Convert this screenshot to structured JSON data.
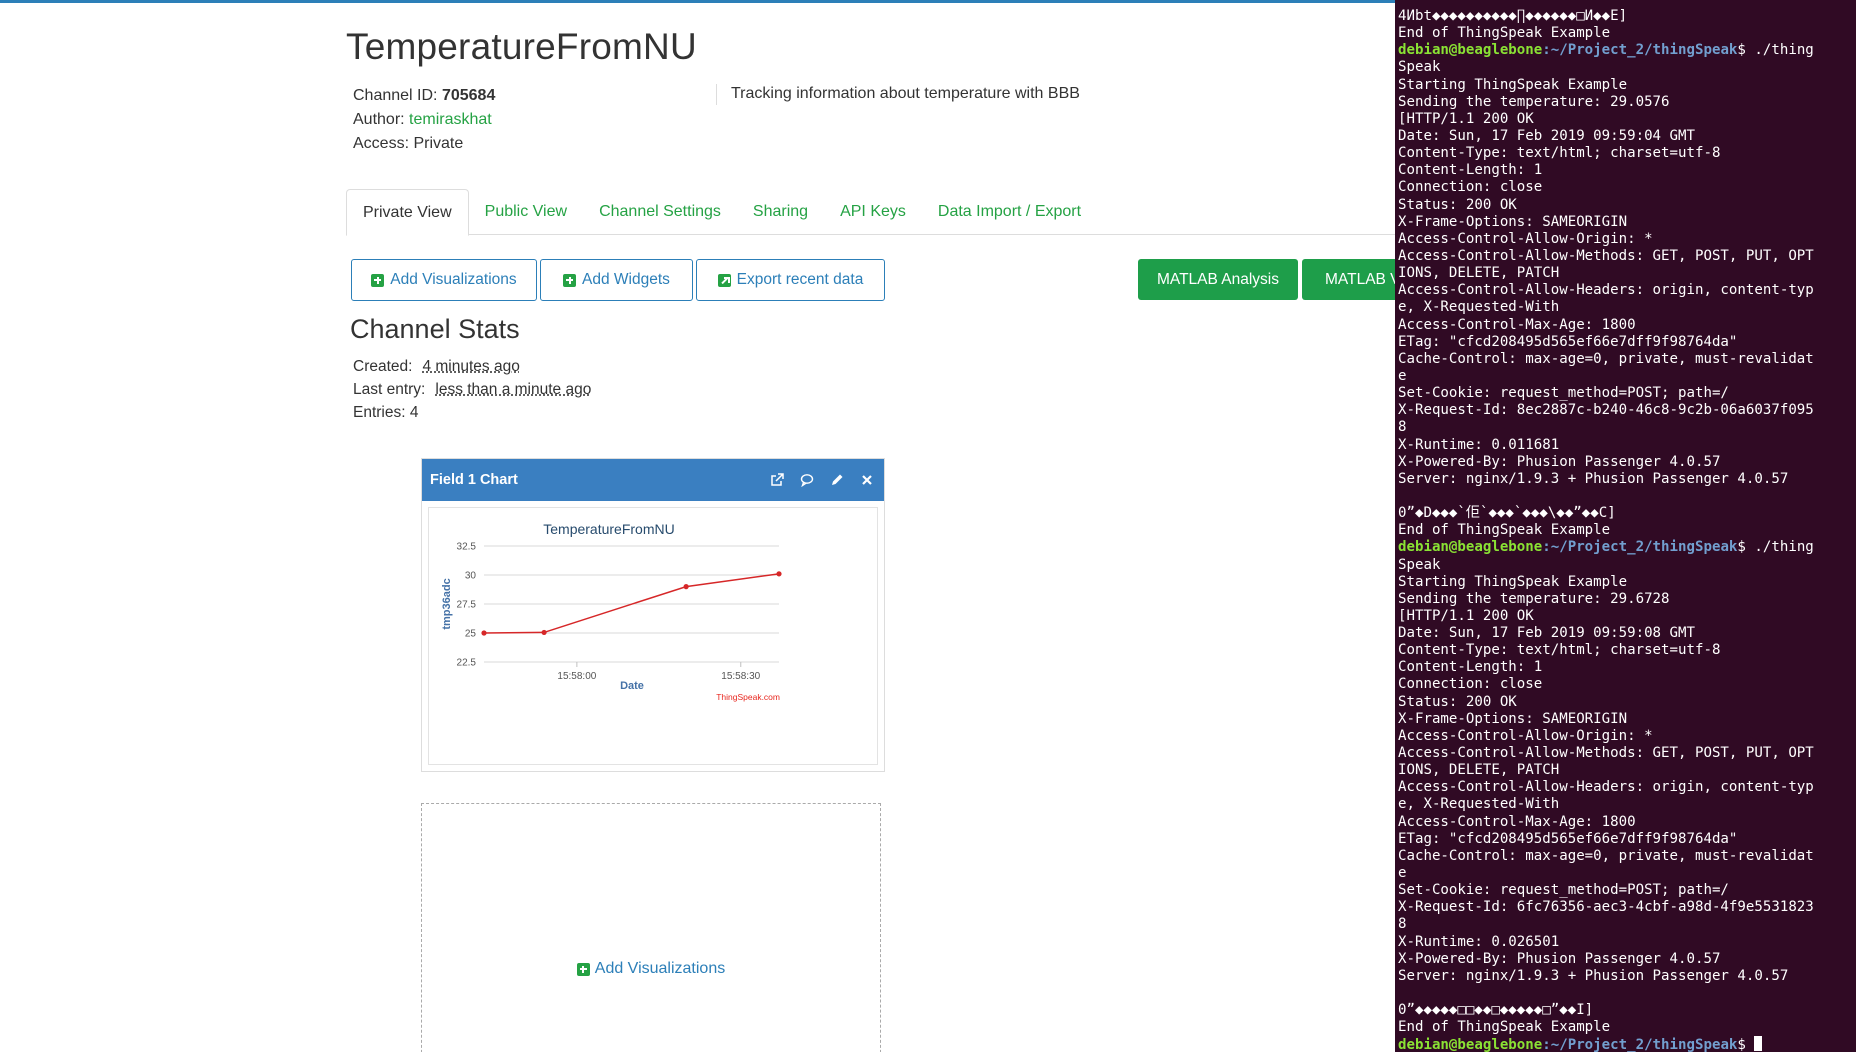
{
  "channel": {
    "title": "TemperatureFromNU",
    "id_label": "Channel ID:",
    "id_value": "705684",
    "author_label": "Author:",
    "author_value": "temiraskhat",
    "access_label": "Access:",
    "access_value": "Private",
    "description": "Tracking information about temperature with BBB"
  },
  "tabs": [
    {
      "label": "Private View",
      "active": true
    },
    {
      "label": "Public View"
    },
    {
      "label": "Channel Settings"
    },
    {
      "label": "Sharing"
    },
    {
      "label": "API Keys"
    },
    {
      "label": "Data Import / Export"
    }
  ],
  "toolbar": {
    "add_visualizations": "Add Visualizations",
    "add_widgets": "Add Widgets",
    "export_recent": "Export recent data",
    "matlab_analysis": "MATLAB Analysis",
    "matlab_visualization": "MATLAB Visualization"
  },
  "stats": {
    "title": "Channel Stats",
    "created_label": "Created:",
    "created_value": "4 minutes ago",
    "last_entry_label": "Last entry:",
    "last_entry_value": "less than a minute ago",
    "entries": "Entries: 4"
  },
  "widget": {
    "title": "Field 1 Chart",
    "icons": [
      "external-link-icon",
      "comment-icon",
      "pencil-icon",
      "close-icon"
    ],
    "header_color": "#3a7fc1"
  },
  "empty_widget": {
    "label": "Add Visualizations"
  },
  "colors": {
    "accent_green": "#25a244",
    "link_blue": "#2c7fb8",
    "button_green": "#1e9e4a",
    "series_red": "#d62728",
    "terminal_bg": "#300a24",
    "prompt_user": "#8ae234",
    "prompt_path": "#729fcf"
  },
  "chart_data": {
    "type": "line",
    "title": "TemperatureFromNU",
    "xlabel": "Date",
    "ylabel": "tmp36adc",
    "credit": "ThingSpeak.com",
    "x_ticks": [
      "15:58:00",
      "15:58:30"
    ],
    "x_tick_seconds": [
      0,
      30
    ],
    "y_ticks": [
      22.5,
      25,
      27.5,
      30,
      32.5
    ],
    "ylim": [
      22.5,
      32.5
    ],
    "xlim_seconds": [
      -17,
      37
    ],
    "grid": true,
    "series": [
      {
        "x_seconds": [
          -17,
          -6,
          20,
          37
        ],
        "values": [
          25,
          25.05,
          29,
          30.1
        ]
      }
    ]
  },
  "terminal": {
    "lines": [
      {
        "text": "4Иbt◆◆◆◆◆◆◆◆◆◆∏◆◆◆◆◆◆□И◆◆E]"
      },
      {
        "text": "End of ThingSpeak Example"
      },
      {
        "prompt": true,
        "user": "debian@beaglebone",
        "path": ":~/Project_2/thingSpeak",
        "cmd": "$ ./thing"
      },
      {
        "text": "Speak"
      },
      {
        "text": "Starting ThingSpeak Example"
      },
      {
        "text": "Sending the temperature: 29.0576"
      },
      {
        "text": "[HTTP/1.1 200 OK"
      },
      {
        "text": "Date: Sun, 17 Feb 2019 09:59:04 GMT"
      },
      {
        "text": "Content-Type: text/html; charset=utf-8"
      },
      {
        "text": "Content-Length: 1"
      },
      {
        "text": "Connection: close"
      },
      {
        "text": "Status: 200 OK"
      },
      {
        "text": "X-Frame-Options: SAMEORIGIN"
      },
      {
        "text": "Access-Control-Allow-Origin: *"
      },
      {
        "text": "Access-Control-Allow-Methods: GET, POST, PUT, OPT"
      },
      {
        "text": "IONS, DELETE, PATCH"
      },
      {
        "text": "Access-Control-Allow-Headers: origin, content-typ"
      },
      {
        "text": "e, X-Requested-With"
      },
      {
        "text": "Access-Control-Max-Age: 1800"
      },
      {
        "text": "ETag: \"cfcd208495d565ef66e7dff9f98764da\""
      },
      {
        "text": "Cache-Control: max-age=0, private, must-revalidat"
      },
      {
        "text": "e"
      },
      {
        "text": "Set-Cookie: request_method=POST; path=/"
      },
      {
        "text": "X-Request-Id: 8ec2887c-b240-46c8-9c2b-06a6037f095"
      },
      {
        "text": "8"
      },
      {
        "text": "X-Runtime: 0.011681"
      },
      {
        "text": "X-Powered-By: Phusion Passenger 4.0.57"
      },
      {
        "text": "Server: nginx/1.9.3 + Phusion Passenger 4.0.57"
      },
      {
        "text": ""
      },
      {
        "text": "0ˮ◆D◆◆◆`佢`◆◆◆`◆◆◆\\◆◆ˮ◆◆C]"
      },
      {
        "text": "End of ThingSpeak Example"
      },
      {
        "prompt": true,
        "user": "debian@beaglebone",
        "path": ":~/Project_2/thingSpeak",
        "cmd": "$ ./thing"
      },
      {
        "text": "Speak"
      },
      {
        "text": "Starting ThingSpeak Example"
      },
      {
        "text": "Sending the temperature: 29.6728"
      },
      {
        "text": "[HTTP/1.1 200 OK"
      },
      {
        "text": "Date: Sun, 17 Feb 2019 09:59:08 GMT"
      },
      {
        "text": "Content-Type: text/html; charset=utf-8"
      },
      {
        "text": "Content-Length: 1"
      },
      {
        "text": "Connection: close"
      },
      {
        "text": "Status: 200 OK"
      },
      {
        "text": "X-Frame-Options: SAMEORIGIN"
      },
      {
        "text": "Access-Control-Allow-Origin: *"
      },
      {
        "text": "Access-Control-Allow-Methods: GET, POST, PUT, OPT"
      },
      {
        "text": "IONS, DELETE, PATCH"
      },
      {
        "text": "Access-Control-Allow-Headers: origin, content-typ"
      },
      {
        "text": "e, X-Requested-With"
      },
      {
        "text": "Access-Control-Max-Age: 1800"
      },
      {
        "text": "ETag: \"cfcd208495d565ef66e7dff9f98764da\""
      },
      {
        "text": "Cache-Control: max-age=0, private, must-revalidat"
      },
      {
        "text": "e"
      },
      {
        "text": "Set-Cookie: request_method=POST; path=/"
      },
      {
        "text": "X-Request-Id: 6fc76356-aec3-4cbf-a98d-4f9e5531823"
      },
      {
        "text": "8"
      },
      {
        "text": "X-Runtime: 0.026501"
      },
      {
        "text": "X-Powered-By: Phusion Passenger 4.0.57"
      },
      {
        "text": "Server: nginx/1.9.3 + Phusion Passenger 4.0.57"
      },
      {
        "text": ""
      },
      {
        "text": "0ˮ◆◆◆◆◆□□◆◆□◆◆◆◆◆□ˮ◆◆I]"
      },
      {
        "text": "End of ThingSpeak Example"
      },
      {
        "prompt": true,
        "user": "debian@beaglebone",
        "path": ":~/Project_2/thingSpeak",
        "cmd": "$ ",
        "cursor": true
      }
    ]
  }
}
